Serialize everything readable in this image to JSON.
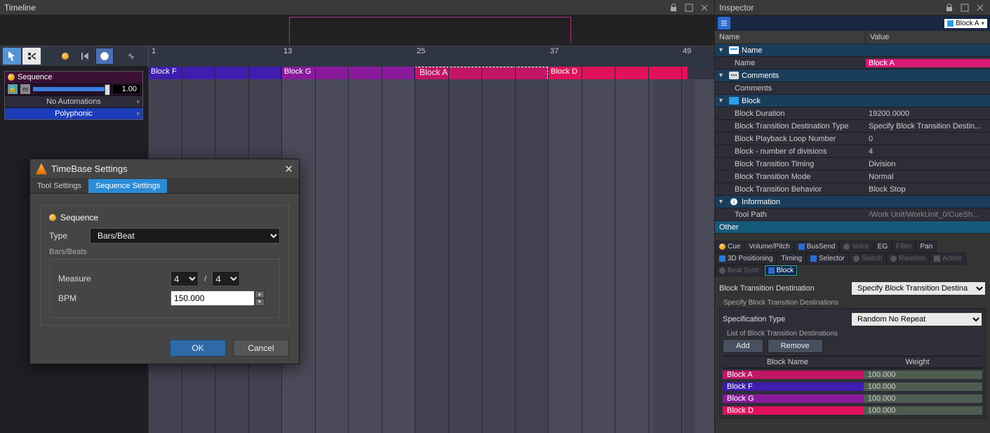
{
  "timeline": {
    "title": "Timeline",
    "ruler_marks": [
      "1",
      "13",
      "25",
      "37",
      "49"
    ],
    "sequence_panel": {
      "title": "Sequence",
      "slider_value": "1.00",
      "automations_label": "No Automations",
      "mode_label": "Polyphonic"
    },
    "blocks": [
      {
        "label": "Block F",
        "color": "#3e1db0",
        "sel": false
      },
      {
        "label": "Block G",
        "color": "#8a1a9c",
        "sel": false
      },
      {
        "label": "Block A",
        "color": "#c11566",
        "sel": true
      },
      {
        "label": "Block D",
        "color": "#e0125a",
        "sel": false
      }
    ]
  },
  "dialog": {
    "title": "TimeBase Settings",
    "tabs": [
      "Tool Settings",
      "Sequence Settings"
    ],
    "active_tab": 1,
    "group_title": "Sequence",
    "type_label": "Type",
    "type_value": "Bars/Beat",
    "subhead": "Bars/Beats",
    "measure_label": "Measure",
    "measure_num": "4",
    "measure_den": "4",
    "bpm_label": "BPM",
    "bpm_value": "150.000",
    "ok": "OK",
    "cancel": "Cancel"
  },
  "inspector": {
    "title": "Inspector",
    "chip_label": "Block A",
    "columns": [
      "Name",
      "Value"
    ],
    "sections": {
      "name_section": "Name",
      "name_field": "Name",
      "name_value": "Block A",
      "comments_section": "Comments",
      "comments_field": "Comments",
      "block_section": "Block",
      "block_duration_label": "Block Duration",
      "block_duration_value": "19200.0000",
      "btdt_label": "Block Transition Destination Type",
      "btdt_value": "Specify Block Transition Destin...",
      "loop_label": "Block Playback Loop Number",
      "loop_value": "0",
      "div_label": "Block - number of divisions",
      "div_value": "4",
      "timing_label": "Block Transition Timing",
      "timing_value": "Division",
      "mode_label": "Block Transition Mode",
      "mode_value": "Normal",
      "behavior_label": "Block Transition Behavior",
      "behavior_value": "Block Stop",
      "info_section": "Information",
      "toolpath_label": "Tool Path",
      "toolpath_value": "/Work Unit/WorkUnit_0/CueSh...",
      "other_section": "Other"
    },
    "category_tabs": {
      "cue": "Cue",
      "volpitch": "Volume/Pitch",
      "bussend": "BusSend",
      "voice": "Voice",
      "eg": "EG",
      "filter": "Filter",
      "pan": "Pan",
      "pos3d": "3D Positioning",
      "timing": "Timing",
      "selector": "Selector",
      "switch": "Switch",
      "random": "Random",
      "action": "Action",
      "beatsync": "Beat Sync",
      "block": "Block"
    },
    "btd_label": "Block Transition Destination",
    "btd_value": "Specify Block Transition Destina",
    "spec_caption": "Specify Block Transition Destinations",
    "spec_type_label": "Specification Type",
    "spec_type_value": "Random No Repeat",
    "list_caption": "List of Block Transition Destinations",
    "add_btn": "Add",
    "remove_btn": "Remove",
    "dest_cols": [
      "Block Name",
      "Weight"
    ],
    "dest_rows": [
      {
        "name": "Block A",
        "color": "#c11566",
        "weight": "100.000"
      },
      {
        "name": "Block F",
        "color": "#3e1db0",
        "weight": "100.000"
      },
      {
        "name": "Block G",
        "color": "#8a1a9c",
        "weight": "100.000"
      },
      {
        "name": "Block D",
        "color": "#e0125a",
        "weight": "100.000"
      }
    ]
  }
}
